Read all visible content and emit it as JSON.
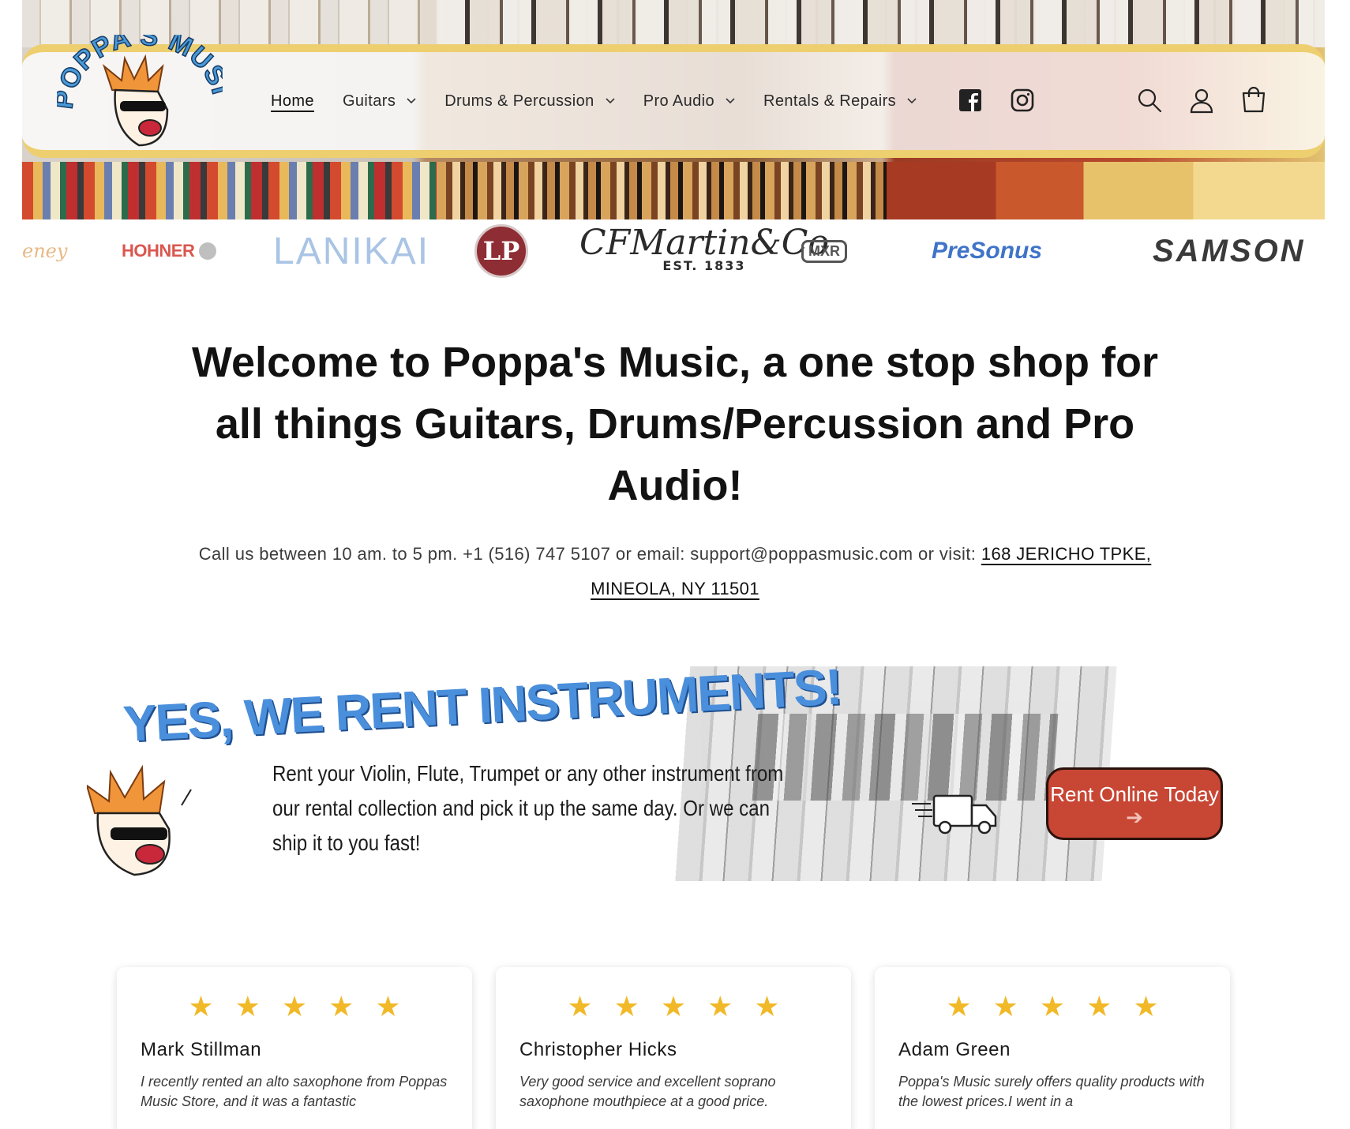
{
  "header": {
    "logo_text": "POPPA'S MUSIC",
    "nav": [
      {
        "label": "Home",
        "dropdown": false
      },
      {
        "label": "Guitars",
        "dropdown": true
      },
      {
        "label": "Drums & Percussion",
        "dropdown": true
      },
      {
        "label": "Pro Audio",
        "dropdown": true
      },
      {
        "label": "Rentals & Repairs",
        "dropdown": true
      }
    ],
    "social_icons": [
      "facebook-icon",
      "instagram-icon"
    ],
    "utility_icons": [
      "search-icon",
      "account-icon",
      "cart-icon"
    ],
    "accent_color": "#eecf70"
  },
  "brands": {
    "eney": "eney",
    "hohner": "HOHNER",
    "lanikai": "LANIKAI",
    "lp": "LP",
    "martin": "CFMartin&Co",
    "martin_est": "EST. 1833",
    "mxr": "MXR",
    "presonus": "PreSonus",
    "samson": "SAMSON"
  },
  "welcome": {
    "bold": "Welcome to Poppa's Music",
    "rest": ", a one stop shop for all things Guitars, Drums/Percussion and Pro Audio!"
  },
  "contact": {
    "text": "Call us between 10 am. to 5 pm. +1 (516) 747 5107 or email: support@poppasmusic.com or visit: ",
    "address_link": "168 JERICHO TPKE, MINEOLA, NY 11501"
  },
  "rental": {
    "headline": "YES, WE RENT INSTRUMENTS!",
    "copy": "Rent your Violin, Flute, Trumpet or any other instrument from our rental collection and pick it up the same day. Or we can ship it to you fast!",
    "cta": "Rent Online Today",
    "cta_color": "#c84634",
    "headline_color": "#4a8fdc"
  },
  "reviews": [
    {
      "rating": 5,
      "stars": "★★★★★",
      "name": "Mark Stillman",
      "text": "I recently rented an alto saxophone from Poppas Music Store, and it was a fantastic"
    },
    {
      "rating": 5,
      "stars": "★★★★★",
      "name": "Christopher Hicks",
      "text": "Very good service and excellent soprano saxophone mouthpiece at a good price."
    },
    {
      "rating": 5,
      "stars": "★★★★★",
      "name": "Adam Green",
      "text": "Poppa's Music surely offers quality products with the lowest prices.I went in a"
    }
  ],
  "star_color": "#f1b928"
}
